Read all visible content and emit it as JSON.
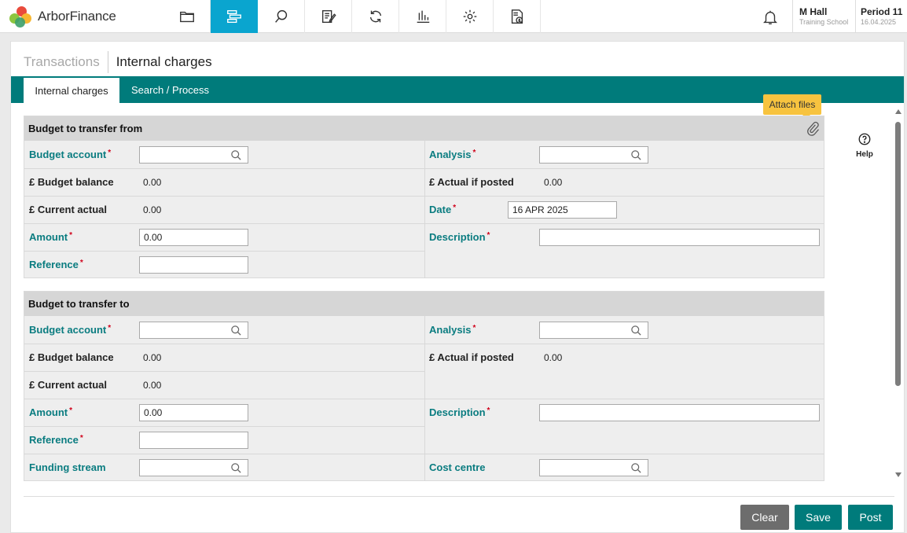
{
  "app": {
    "brand": "ArborFinance"
  },
  "nav": [
    {
      "icon": "folder-icon"
    },
    {
      "icon": "transfer-icon"
    },
    {
      "icon": "search-icon"
    },
    {
      "icon": "edit-document-icon"
    },
    {
      "icon": "refresh-cycle-icon"
    },
    {
      "icon": "bar-chart-icon"
    },
    {
      "icon": "settings-gear-icon"
    },
    {
      "icon": "invoice-pound-icon"
    }
  ],
  "user": {
    "name": "M Hall",
    "school": "Training School"
  },
  "period": {
    "label": "Period 11",
    "date": "16.04.2025"
  },
  "breadcrumb": {
    "parent": "Transactions",
    "current": "Internal charges"
  },
  "tabs": {
    "active": "Internal charges",
    "other": "Search / Process"
  },
  "attach_tooltip": "Attach files",
  "help_label": "Help",
  "from": {
    "title": "Budget to transfer from",
    "budget_account_label": "Budget account",
    "analysis_label": "Analysis",
    "budget_balance_label": "£ Budget balance",
    "budget_balance": "0.00",
    "actual_if_posted_label": "£ Actual if posted",
    "actual_if_posted": "0.00",
    "current_actual_label": "£ Current actual",
    "current_actual": "0.00",
    "date_label": "Date",
    "date_value": "16 APR 2025",
    "amount_label": "Amount",
    "amount_value": "0.00",
    "description_label": "Description",
    "reference_label": "Reference"
  },
  "to": {
    "title": "Budget to transfer to",
    "budget_account_label": "Budget account",
    "analysis_label": "Analysis",
    "budget_balance_label": "£ Budget balance",
    "budget_balance": "0.00",
    "actual_if_posted_label": "£ Actual if posted",
    "actual_if_posted": "0.00",
    "current_actual_label": "£ Current actual",
    "current_actual": "0.00",
    "amount_label": "Amount",
    "amount_value": "0.00",
    "description_label": "Description",
    "reference_label": "Reference",
    "funding_stream_label": "Funding stream",
    "cost_centre_label": "Cost centre"
  },
  "required_mark": "*",
  "buttons": {
    "clear": "Clear",
    "save": "Save",
    "post": "Post"
  },
  "colors": {
    "teal": "#007b7b",
    "nav_active": "#0aa5cf",
    "tooltip": "#f7c33f",
    "clear_btn": "#6d6d6d",
    "label_teal": "#0a7c80",
    "required": "#d0021b"
  }
}
